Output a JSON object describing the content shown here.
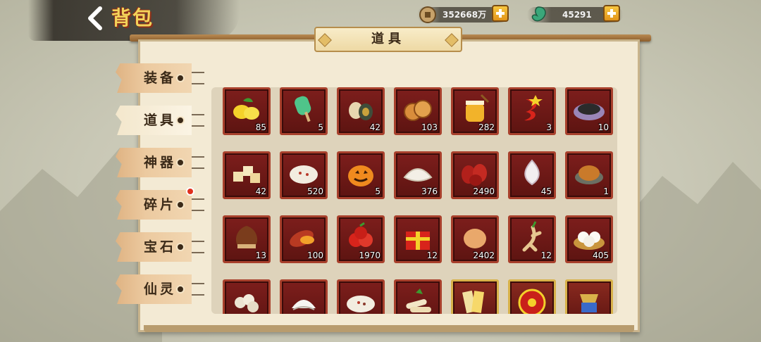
{
  "header": {
    "title": "背包"
  },
  "currencies": [
    {
      "icon": "coin-icon",
      "amount": "352668万"
    },
    {
      "icon": "jade-icon",
      "amount": "45291"
    }
  ],
  "panel": {
    "title": "道具"
  },
  "tabs": [
    {
      "label": "装备",
      "active": false,
      "badge": false
    },
    {
      "label": "道具",
      "active": true,
      "badge": false
    },
    {
      "label": "神器",
      "active": false,
      "badge": false
    },
    {
      "label": "碎片",
      "active": false,
      "badge": true
    },
    {
      "label": "宝石",
      "active": false,
      "badge": false
    },
    {
      "label": "仙灵",
      "active": false,
      "badge": false
    }
  ],
  "items": [
    {
      "icon": "lemon-icon",
      "count": "85",
      "frame": "red"
    },
    {
      "icon": "popsicle-icon",
      "count": "5",
      "frame": "red"
    },
    {
      "icon": "preserved-egg-icon",
      "count": "42",
      "frame": "red"
    },
    {
      "icon": "mooncake-icon",
      "count": "103",
      "frame": "red"
    },
    {
      "icon": "honey-jar-icon",
      "count": "282",
      "frame": "red"
    },
    {
      "icon": "chili-pepper-icon",
      "count": "3",
      "frame": "red"
    },
    {
      "icon": "black-sesame-icon",
      "count": "10",
      "frame": "red"
    },
    {
      "icon": "tofu-cubes-icon",
      "count": "42",
      "frame": "red"
    },
    {
      "icon": "porridge-icon",
      "count": "520",
      "frame": "red"
    },
    {
      "icon": "pumpkin-icon",
      "count": "5",
      "frame": "red"
    },
    {
      "icon": "dumpling-icon",
      "count": "376",
      "frame": "red"
    },
    {
      "icon": "red-dates-icon",
      "count": "2490",
      "frame": "red"
    },
    {
      "icon": "garlic-icon",
      "count": "45",
      "frame": "red"
    },
    {
      "icon": "roast-chicken-icon",
      "count": "1",
      "frame": "red"
    },
    {
      "icon": "chestnut-icon",
      "count": "13",
      "frame": "red"
    },
    {
      "icon": "sweet-potato-icon",
      "count": "100",
      "frame": "red"
    },
    {
      "icon": "apple-icon",
      "count": "1970",
      "frame": "red"
    },
    {
      "icon": "gift-box-icon",
      "count": "12",
      "frame": "red"
    },
    {
      "icon": "egg-icon",
      "count": "2402",
      "frame": "red"
    },
    {
      "icon": "ginseng-icon",
      "count": "12",
      "frame": "red"
    },
    {
      "icon": "steamed-buns-icon",
      "count": "405",
      "frame": "red"
    },
    {
      "icon": "rice-cakes-icon",
      "count": "",
      "frame": "red"
    },
    {
      "icon": "coconut-icon",
      "count": "",
      "frame": "red"
    },
    {
      "icon": "congee-icon",
      "count": "",
      "frame": "red"
    },
    {
      "icon": "spring-rolls-icon",
      "count": "",
      "frame": "red"
    },
    {
      "icon": "talisman-icon",
      "count": "",
      "frame": "gold"
    },
    {
      "icon": "fan-disc-icon",
      "count": "",
      "frame": "gold"
    },
    {
      "icon": "treasure-icon",
      "count": "",
      "frame": "gold"
    }
  ],
  "colors": {
    "slot_red": "#6b1a17",
    "slot_border_red": "#a8402c",
    "slot_border_gold": "#d8b24a",
    "title_gold": "#f3d35a"
  }
}
